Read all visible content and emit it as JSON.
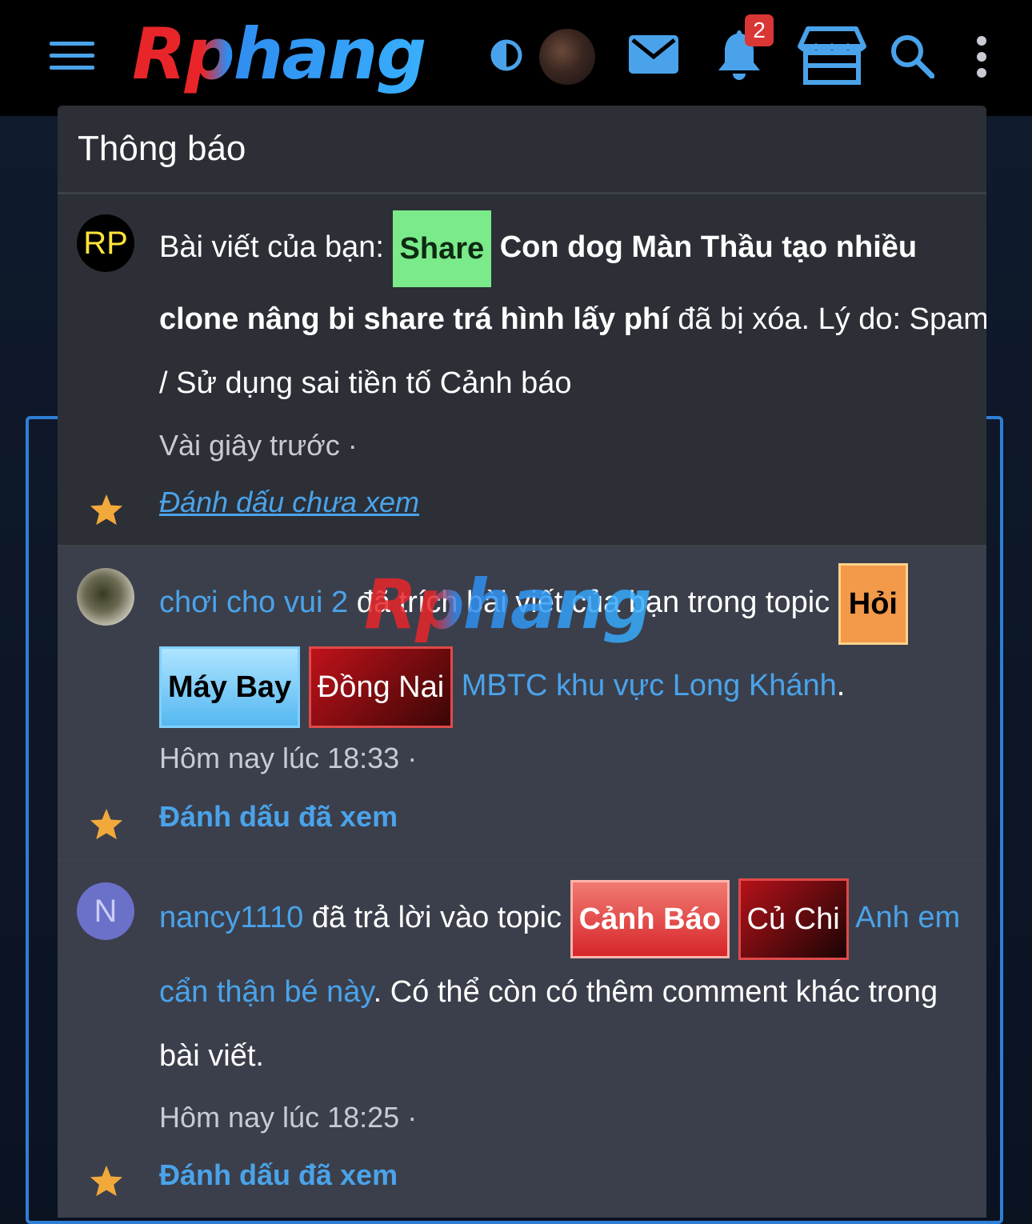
{
  "header": {
    "logo_text": "Rphang",
    "notification_count": "2",
    "icons": [
      "menu-icon",
      "contrast-icon",
      "mail-icon",
      "bell-icon",
      "store-icon",
      "search-icon",
      "more-icon"
    ]
  },
  "panel": {
    "title": "Thông báo",
    "notifications": [
      {
        "avatar_text": "RP",
        "prefix": "Bài viết của bạn:",
        "tag": "Share",
        "title_a": "Con dog Màn Thầu tạo nhiều",
        "title_b": "clone nâng bi share trá hình lấy phí",
        "suffix": "đã bị xóa. Lý do: Spam",
        "line3": "/ Sử dụng sai tiền tố Cảnh báo",
        "time": "Vài giây trước",
        "dot": "·",
        "action": "Đánh dấu chưa xem"
      },
      {
        "user": "chơi cho vui 2",
        "verb": "đã trích bài viết của bạn trong topic",
        "tag1": "Hỏi",
        "tag2": "Máy Bay",
        "tag3": "Đồng Nai",
        "topic": "MBTC khu vực Long Khánh",
        "end": ".",
        "time": "Hôm nay lúc 18:33",
        "dot": "·",
        "action": "Đánh dấu đã xem"
      },
      {
        "avatar_text": "N",
        "user": "nancy1110",
        "verb": "đã trả lời vào topic",
        "tag1": "Cảnh Báo",
        "tag2": "Củ Chi",
        "topic_a": "Anh em",
        "topic_b": "cẩn thận bé này",
        "more_a": ". Có thể còn có thêm comment khác trong",
        "more_b": "bài viết.",
        "time": "Hôm nay lúc 18:25",
        "dot": "·",
        "action": "Đánh dấu đã xem"
      }
    ]
  },
  "watermark_text": "Rphang",
  "colors": {
    "accent": "#4aa3ea",
    "panel_bg": "#2c2f36",
    "unread_bg": "#3b3f4b",
    "badge": "#d93636",
    "star": "#f2a93b"
  }
}
